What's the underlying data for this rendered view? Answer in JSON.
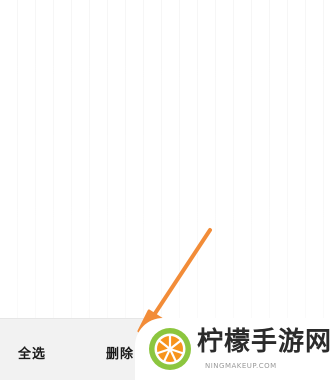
{
  "bottom_bar": {
    "select_all_label": "全选",
    "delete_label": "删除"
  },
  "watermark": {
    "title": "柠檬手游网",
    "subtitle": "NINGMAKEUP.COM"
  },
  "colors": {
    "arrow": "#f28c38",
    "bar_background": "#f2f2f2",
    "logo_green": "#8cc63f",
    "logo_orange": "#f7941d"
  },
  "icons": {
    "arrow": "arrow-icon",
    "logo": "lemon-logo-icon"
  }
}
